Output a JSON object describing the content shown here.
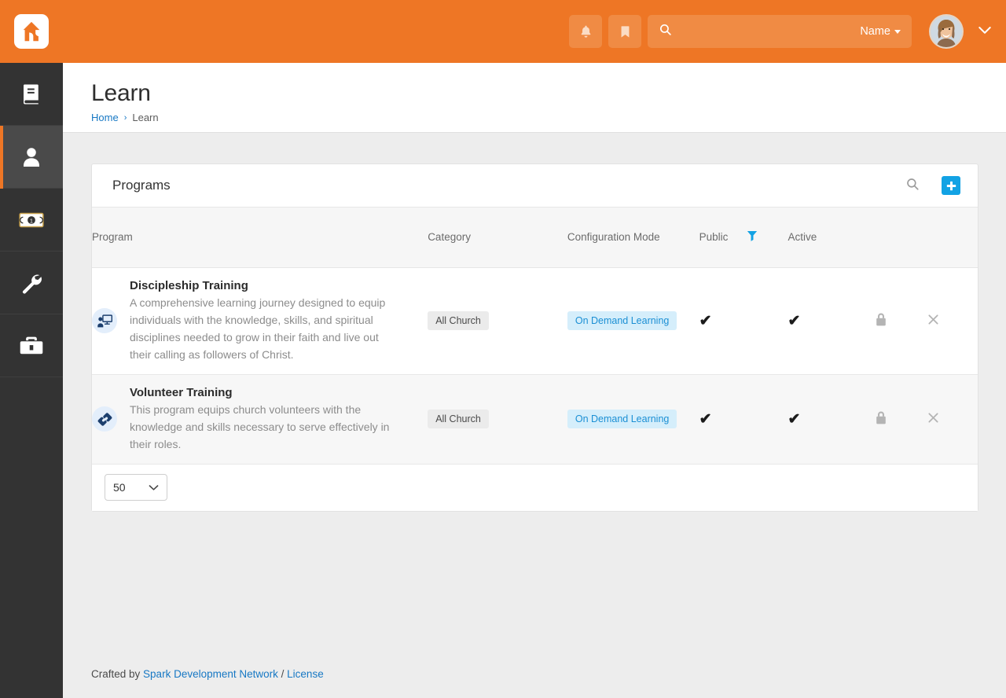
{
  "topbar": {
    "logo_icon": "rock-rms-logo",
    "notification_icon": "bell-icon",
    "bookmark_icon": "bookmark-icon",
    "search": {
      "icon": "search-icon",
      "value": "",
      "placeholder": ""
    },
    "name_filter_label": "Name",
    "avatar_icon": "user-avatar",
    "profile_chevron_icon": "chevron-down-icon",
    "accent_color": "#ee7625"
  },
  "sidebar": {
    "items": [
      {
        "name": "sidebar-item-cms",
        "icon": "book-icon",
        "active": false
      },
      {
        "name": "sidebar-item-people",
        "icon": "person-icon",
        "active": true
      },
      {
        "name": "sidebar-item-finance",
        "icon": "money-icon",
        "active": false
      },
      {
        "name": "sidebar-item-tools",
        "icon": "wrench-icon",
        "active": false
      },
      {
        "name": "sidebar-item-admin",
        "icon": "toolbox-icon",
        "active": false
      }
    ]
  },
  "page": {
    "title": "Learn",
    "breadcrumb": {
      "home": "Home",
      "separator": "›",
      "current": "Learn"
    }
  },
  "panel": {
    "title": "Programs",
    "search_icon": "search-icon",
    "add_icon": "plus-icon",
    "add_button_color": "#12a2e4"
  },
  "table": {
    "columns": [
      {
        "key": "program",
        "label": "Program"
      },
      {
        "key": "category",
        "label": "Category"
      },
      {
        "key": "config",
        "label": "Configuration Mode"
      },
      {
        "key": "public",
        "label": "Public",
        "filter_icon": "filter-funnel-icon"
      },
      {
        "key": "active",
        "label": "Active"
      },
      {
        "key": "security",
        "label": ""
      },
      {
        "key": "delete",
        "label": ""
      }
    ],
    "rows": [
      {
        "icon": "chalkboard-teacher-icon",
        "name": "Discipleship Training",
        "description": "A comprehensive learning journey designed to equip individuals with the knowledge, skills, and spiritual disciplines needed to grow in their faith and live out their calling as followers of Christ.",
        "category": "All Church",
        "config_mode": "On Demand Learning",
        "public": "✔",
        "active": "✔",
        "security_icon": "lock-icon",
        "delete_icon": "close-x-icon"
      },
      {
        "icon": "hands-helping-icon",
        "name": "Volunteer Training",
        "description": "This program equips church volunteers with the knowledge and skills necessary to serve effectively in their roles.",
        "category": "All Church",
        "config_mode": "On Demand Learning",
        "public": "✔",
        "active": "✔",
        "security_icon": "lock-icon",
        "delete_icon": "close-x-icon"
      }
    ],
    "page_size": {
      "value": "50",
      "chevron_icon": "chevron-down-icon"
    }
  },
  "footer": {
    "prefix": "Crafted by",
    "link1": "Spark Development Network",
    "divider": "/",
    "link2": "License"
  }
}
